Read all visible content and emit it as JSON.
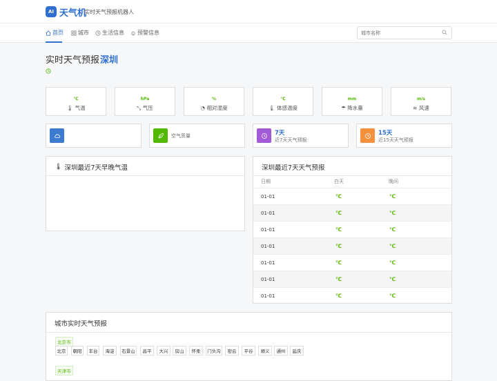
{
  "header": {
    "logo_mark": "AI",
    "logo_text": "天气机",
    "slogan": "实时天气预报机器人"
  },
  "nav": {
    "items": [
      {
        "label": "首页",
        "icon": "home-icon",
        "active": true
      },
      {
        "label": "城市",
        "icon": "grid-icon",
        "active": false
      },
      {
        "label": "生活信息",
        "icon": "clock-icon",
        "active": false
      },
      {
        "label": "预警信息",
        "icon": "bell-icon",
        "active": false
      }
    ],
    "search_placeholder": "城市名称"
  },
  "page": {
    "title": "实时天气预报",
    "city": "深圳"
  },
  "stats": [
    {
      "unit": "℃",
      "label": "气温",
      "icon": "thermometer-icon"
    },
    {
      "unit": "hPa",
      "label": "气压",
      "icon": "pressure-icon"
    },
    {
      "unit": "%",
      "label": "相对湿度",
      "icon": "humidity-icon"
    },
    {
      "unit": "℃",
      "label": "体感温度",
      "icon": "thermometer-icon"
    },
    {
      "unit": "mm",
      "label": "降水量",
      "icon": "rain-icon"
    },
    {
      "unit": "m/s",
      "label": "风速",
      "icon": "wind-icon"
    }
  ],
  "cards": [
    {
      "icon": "cloud-icon",
      "color": "#3d7bd1",
      "big": "",
      "sub": ""
    },
    {
      "icon": "leaf-icon",
      "color": "#52b900",
      "big": "",
      "sub": "空气质量"
    },
    {
      "icon": "clock-icon",
      "color": "#a35ad8",
      "big": "7天",
      "sub": "近7天天气预报"
    },
    {
      "icon": "clock-icon",
      "color": "#f5903d",
      "big": "15天",
      "sub": "近15天天气预报"
    }
  ],
  "temp_panel": {
    "title": "深圳最近7天早晚气温"
  },
  "forecast_panel": {
    "title": "深圳最近7天天气预报",
    "headers": {
      "date": "日期",
      "day": "白天",
      "night": "晚间"
    },
    "rows": [
      {
        "date": "01-01",
        "day": "℃",
        "night": "℃"
      },
      {
        "date": "01-01",
        "day": "℃",
        "night": "℃"
      },
      {
        "date": "01-01",
        "day": "℃",
        "night": "℃"
      },
      {
        "date": "01-01",
        "day": "℃",
        "night": "℃"
      },
      {
        "date": "01-01",
        "day": "℃",
        "night": "℃"
      },
      {
        "date": "01-01",
        "day": "℃",
        "night": "℃"
      },
      {
        "date": "01-01",
        "day": "℃",
        "night": "℃"
      }
    ]
  },
  "city_panel": {
    "title": "城市实时天气预报",
    "provinces": [
      "北京市",
      "天津市"
    ],
    "beijing_cities": [
      "北京",
      "朝阳",
      "丰台",
      "海淀",
      "石景山",
      "昌平",
      "大兴",
      "房山",
      "怀柔",
      "门头沟",
      "密云",
      "平谷",
      "顺义",
      "通州",
      "延庆"
    ]
  },
  "colors": {
    "accent": "#2f6fd0",
    "green": "#52b900"
  }
}
